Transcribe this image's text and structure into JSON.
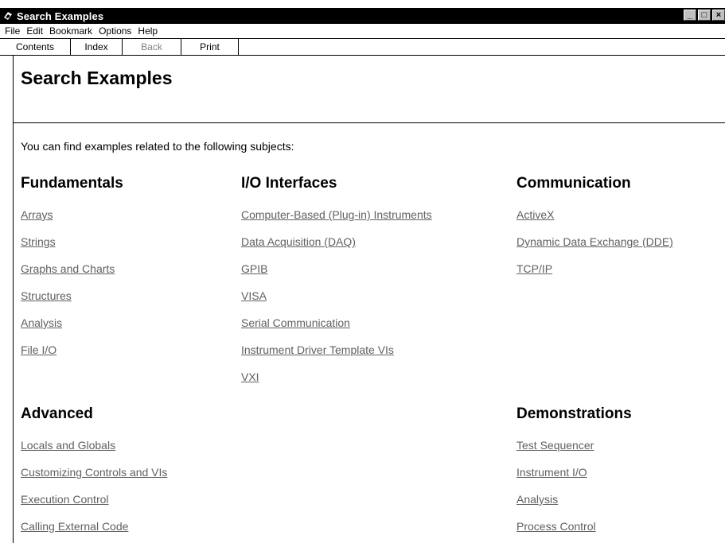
{
  "window": {
    "title": "Search Examples",
    "controls": [
      "_",
      "□",
      "×"
    ]
  },
  "menu": [
    "File",
    "Edit",
    "Bookmark",
    "Options",
    "Help"
  ],
  "toolbar": [
    {
      "label": "Contents",
      "enabled": true
    },
    {
      "label": "Index",
      "enabled": true
    },
    {
      "label": "Back",
      "enabled": false
    },
    {
      "label": "Print",
      "enabled": true
    }
  ],
  "page": {
    "title": "Search Examples",
    "intro": "You can find examples related to the following subjects:"
  },
  "sections": {
    "fundamentals": {
      "heading": "Fundamentals",
      "links": [
        "Arrays",
        "Strings",
        "Graphs and Charts",
        "Structures",
        "Analysis",
        "File I/O"
      ]
    },
    "io_interfaces": {
      "heading": "I/O Interfaces",
      "links": [
        "Computer-Based (Plug-in) Instruments",
        "Data Acquisition (DAQ)",
        "GPIB",
        "VISA",
        "Serial Communication",
        "Instrument Driver Template VIs",
        "VXI"
      ]
    },
    "communication": {
      "heading": "Communication",
      "links": [
        "ActiveX",
        "Dynamic Data Exchange (DDE)",
        "TCP/IP"
      ]
    },
    "advanced": {
      "heading": "Advanced",
      "links": [
        "Locals and Globals",
        "Customizing Controls and VIs",
        "Execution Control",
        "Calling External Code"
      ]
    },
    "demonstrations": {
      "heading": "Demonstrations",
      "links": [
        "Test Sequencer",
        "Instrument I/O",
        "Analysis",
        "Process Control"
      ]
    }
  },
  "colors": {
    "link": "#606060",
    "titlebar": "#000000"
  },
  "icons": {
    "app": "help-book-icon"
  }
}
